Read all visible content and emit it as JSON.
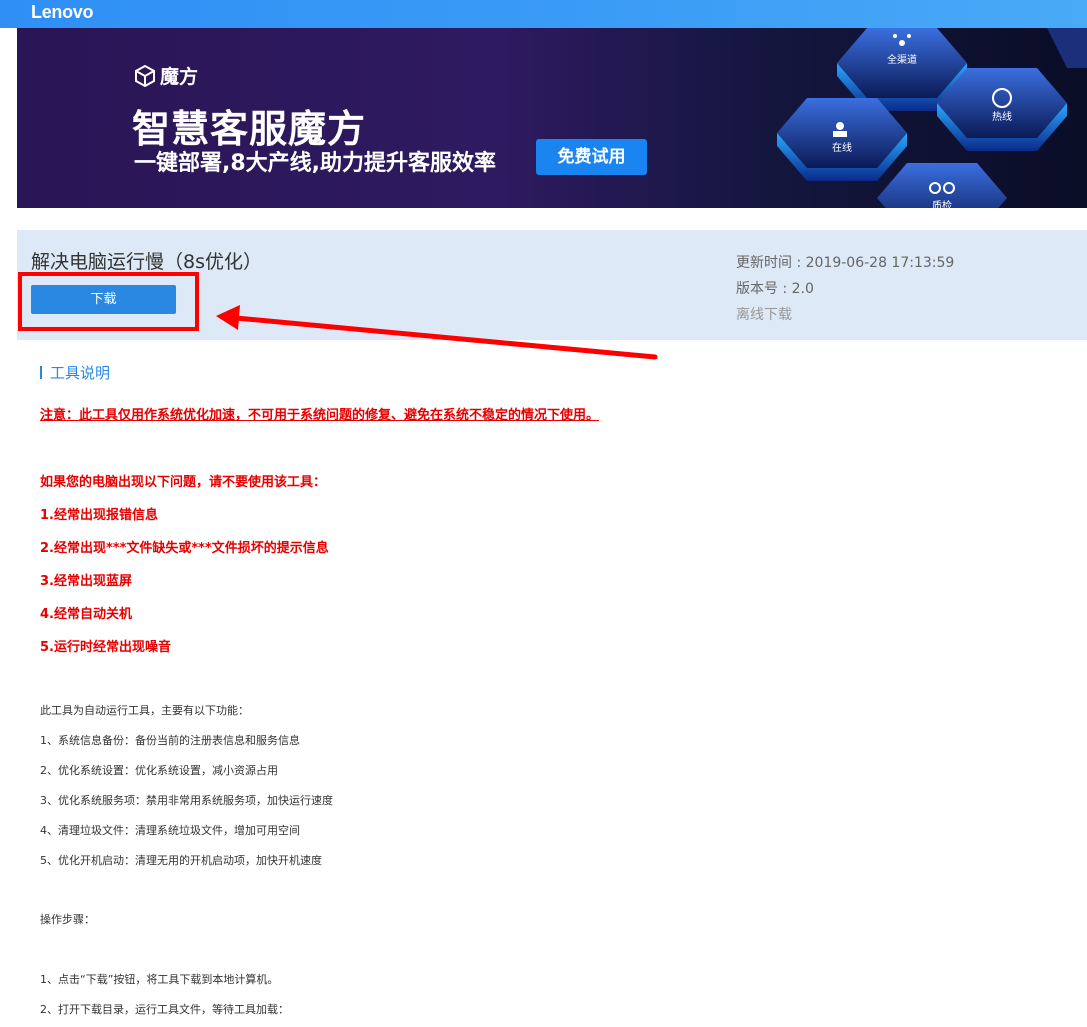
{
  "header": {
    "brand": "Lenovo"
  },
  "banner": {
    "product_logo_text": "魔方",
    "title": "智慧客服魔方",
    "subtitle": "一键部署,8大产线,助力提升客服效率",
    "cta_label": "免费试用",
    "hex_labels": [
      "全渠道",
      "热线",
      "在线",
      "质检"
    ]
  },
  "tool": {
    "title": "解决电脑运行慢（8s优化）",
    "download_label": "下载",
    "update_time": "更新时间 : 2019-06-28 17:13:59",
    "version": "版本号 : 2.0",
    "offline_download": "离线下载"
  },
  "description": {
    "section_title": "工具说明",
    "warning": "注意：此工具仅用作系统优化加速，不可用于系统问题的修复、避免在系统不稳定的情况下使用。",
    "problems_intro": "如果您的电脑出现以下问题，请不要使用该工具：",
    "problems": [
      "1.经常出现报错信息",
      "2.经常出现***文件缺失或***文件损坏的提示信息",
      "3.经常出现蓝屏",
      "4.经常自动关机",
      "5.运行时经常出现噪音"
    ],
    "features_intro": "此工具为自动运行工具，主要有以下功能：",
    "features": [
      "1、系统信息备份：备份当前的注册表信息和服务信息",
      "2、优化系统设置：优化系统设置，减小资源占用",
      "3、优化系统服务项：禁用非常用系统服务项，加快运行速度",
      "4、清理垃圾文件：清理系统垃圾文件，增加可用空间",
      "5、优化开机启动：清理无用的开机启动项，加快开机速度"
    ],
    "steps_intro": "操作步骤：",
    "steps": [
      "1、点击“下载”按钮，将工具下载到本地计算机。",
      "2、打开下载目录，运行工具文件，等待工具加载："
    ]
  },
  "colors": {
    "topbar": "#2f8ff5",
    "panel_bg": "#dde9f6",
    "button": "#2b88e2",
    "annotation_red": "#ff0000",
    "warning_red": "#e60000"
  }
}
